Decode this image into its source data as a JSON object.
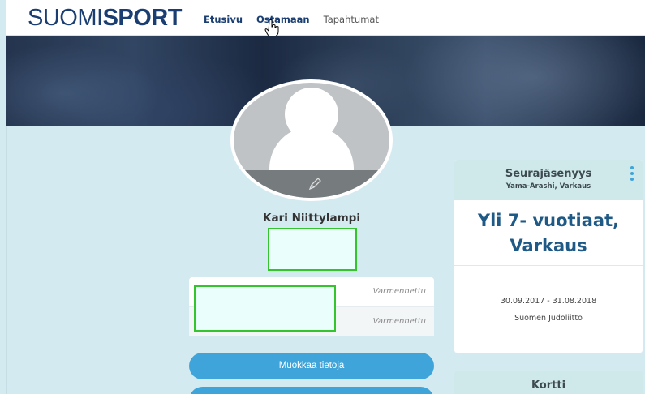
{
  "header": {
    "logo_light": "SUOMI",
    "logo_bold": "SPORT",
    "nav": [
      "Etusivu",
      "Ostamaan",
      "Tapahtumat"
    ]
  },
  "profile": {
    "name": "Kari Niittylampi",
    "verified_labels": [
      "Varmennettu",
      "Varmennettu"
    ],
    "edit_button": "Muokkaa tietoja"
  },
  "membership_card": {
    "title": "Seurajäsenyys",
    "subtitle": "Yama-Arashi, Varkaus",
    "category_line1": "Yli 7- vuotiaat,",
    "category_line2": "Varkaus",
    "dates": "30.09.2017 - 31.08.2018",
    "organization": "Suomen Judoliitto"
  },
  "second_card": {
    "title": "Kortti"
  },
  "colors": {
    "brand": "#1a3e72",
    "accent": "#3ea4d9",
    "background": "#d4eaf1",
    "card_header": "#cfe9ea"
  }
}
